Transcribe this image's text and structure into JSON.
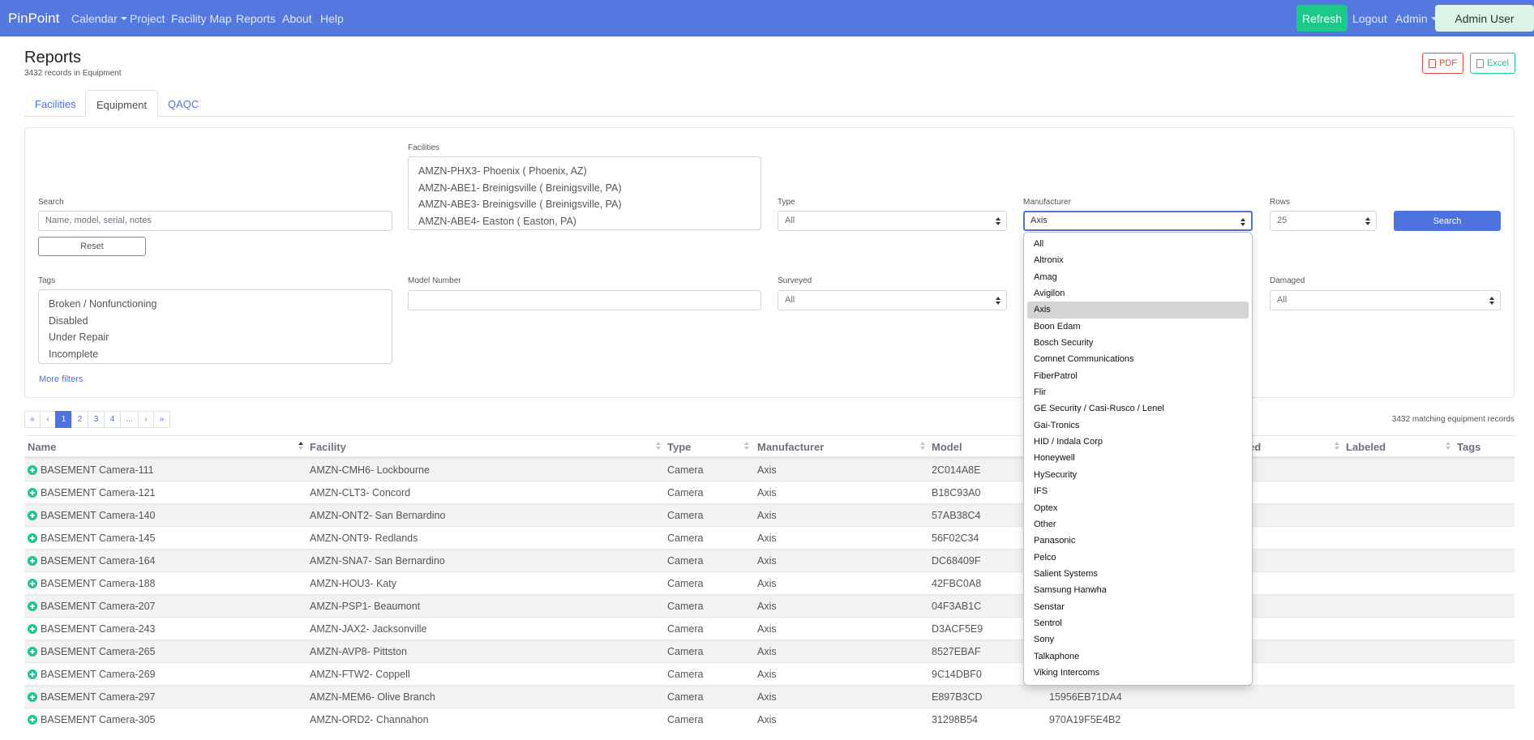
{
  "nav": {
    "brand": "PinPoint",
    "links": [
      "Calendar",
      "Project",
      "Facility Map",
      "Reports",
      "About",
      "Help"
    ],
    "refresh_label": "Refresh",
    "logout_label": "Logout",
    "admin_label": "Admin",
    "user_label": "Admin User"
  },
  "header": {
    "title": "Reports",
    "subtitle": "3432 records in Equipment",
    "pdf_label": "PDF",
    "excel_label": "Excel"
  },
  "tabs": [
    "Facilities",
    "Equipment",
    "QAQC"
  ],
  "filters": {
    "search_label": "Search",
    "search_placeholder": "Name, model, serial, notes",
    "reset_label": "Reset",
    "facilities_label": "Facilities",
    "facilities_options": [
      "AMZN-PHX3- Phoenix ( Phoenix, AZ)",
      "AMZN-ABE1- Breinigsville ( Breinigsville, PA)",
      "AMZN-ABE3- Breinigsville ( Breinigsville, PA)",
      "AMZN-ABE4- Easton ( Easton, PA)"
    ],
    "type_label": "Type",
    "type_value": "All",
    "manufacturer_label": "Manufacturer",
    "manufacturer_value": "Axis",
    "rows_label": "Rows",
    "rows_value": "25",
    "search_button": "Search",
    "tags_label": "Tags",
    "tags_options": [
      "Broken / Nonfunctioning",
      "Disabled",
      "Under Repair",
      "Incomplete"
    ],
    "model_label": "Model Number",
    "surveyed_label": "Surveyed",
    "surveyed_value": "All",
    "damaged_label": "Damaged",
    "damaged_value": "All",
    "more_filters": "More filters"
  },
  "pagination": {
    "first": "«",
    "prev": "‹",
    "pages": [
      "1",
      "2",
      "3",
      "4",
      "..."
    ],
    "next": "›",
    "last": "»",
    "match_count": "3432 matching equipment records"
  },
  "table": {
    "headers": {
      "name": "Name",
      "facility": "Facility",
      "type": "Type",
      "manufacturer": "Manufacturer",
      "model": "Model",
      "ed": "ed",
      "labeled": "Labeled",
      "tags": "Tags"
    },
    "rows": [
      {
        "name": "BASEMENT Camera-111",
        "facility": "AMZN-CMH6- Lockbourne",
        "type": "Camera",
        "manufacturer": "Axis",
        "model": "2C014A8E",
        "serial": ""
      },
      {
        "name": "BASEMENT Camera-121",
        "facility": "AMZN-CLT3- Concord",
        "type": "Camera",
        "manufacturer": "Axis",
        "model": "B18C93A0",
        "serial": ""
      },
      {
        "name": "BASEMENT Camera-140",
        "facility": "AMZN-ONT2- San Bernardino",
        "type": "Camera",
        "manufacturer": "Axis",
        "model": "57AB38C4",
        "serial": ""
      },
      {
        "name": "BASEMENT Camera-145",
        "facility": "AMZN-ONT9- Redlands",
        "type": "Camera",
        "manufacturer": "Axis",
        "model": "56F02C34",
        "serial": ""
      },
      {
        "name": "BASEMENT Camera-164",
        "facility": "AMZN-SNA7- San Bernardino",
        "type": "Camera",
        "manufacturer": "Axis",
        "model": "DC68409F",
        "serial": ""
      },
      {
        "name": "BASEMENT Camera-188",
        "facility": "AMZN-HOU3- Katy",
        "type": "Camera",
        "manufacturer": "Axis",
        "model": "42FBC0A8",
        "serial": ""
      },
      {
        "name": "BASEMENT Camera-207",
        "facility": "AMZN-PSP1- Beaumont",
        "type": "Camera",
        "manufacturer": "Axis",
        "model": "04F3AB1C",
        "serial": ""
      },
      {
        "name": "BASEMENT Camera-243",
        "facility": "AMZN-JAX2- Jacksonville",
        "type": "Camera",
        "manufacturer": "Axis",
        "model": "D3ACF5E9",
        "serial": ""
      },
      {
        "name": "BASEMENT Camera-265",
        "facility": "AMZN-AVP8- Pittston",
        "type": "Camera",
        "manufacturer": "Axis",
        "model": "8527EBAF",
        "serial": ""
      },
      {
        "name": "BASEMENT Camera-269",
        "facility": "AMZN-FTW2- Coppell",
        "type": "Camera",
        "manufacturer": "Axis",
        "model": "9C14DBF0",
        "serial": ""
      },
      {
        "name": "BASEMENT Camera-297",
        "facility": "AMZN-MEM6- Olive Branch",
        "type": "Camera",
        "manufacturer": "Axis",
        "model": "E897B3CD",
        "serial": "15956EB71DA4"
      },
      {
        "name": "BASEMENT Camera-305",
        "facility": "AMZN-ORD2- Channahon",
        "type": "Camera",
        "manufacturer": "Axis",
        "model": "31298B54",
        "serial": "970A19F5E4B2"
      }
    ]
  },
  "manufacturer_dropdown": {
    "options": [
      "All",
      "Altronix",
      "Amag",
      "Avigilon",
      "Axis",
      "Boon Edam",
      "Bosch Security",
      "Comnet Communications",
      "FiberPatrol",
      "Flir",
      "GE Security / Casi-Rusco / Lenel",
      "Gai-Tronics",
      "HID / Indala Corp",
      "Honeywell",
      "HySecurity",
      "IFS",
      "Optex",
      "Other",
      "Panasonic",
      "Pelco",
      "Salient Systems",
      "Samsung Hanwha",
      "Senstar",
      "Sentrol",
      "Sony",
      "Talkaphone",
      "Viking Intercoms"
    ],
    "selected_index": 4
  },
  "colors": {
    "navbar": "#5578df",
    "primary": "#4e73df",
    "success": "#1cc88a",
    "danger": "#e74a3b"
  }
}
